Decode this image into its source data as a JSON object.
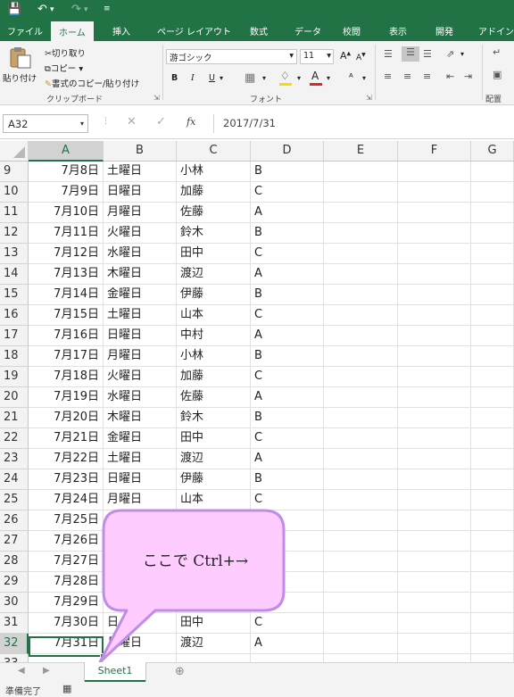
{
  "qat": {
    "save_icon": "save-icon",
    "undo_icon": "undo-icon",
    "redo_icon": "redo-icon",
    "customize_icon": "customize-qat-icon"
  },
  "tabs": [
    "ファイル",
    "ホーム",
    "挿入",
    "ページ レイアウト",
    "数式",
    "データ",
    "校閲",
    "表示",
    "開発",
    "アドイン"
  ],
  "active_tab": "ホーム",
  "ribbon": {
    "paste": "貼り付け",
    "cut": "切り取り",
    "copy": "コピー",
    "format_painter": "書式のコピー/貼り付け",
    "clipboard_group": "クリップボード",
    "font_name": "游ゴシック",
    "font_size": "11",
    "font_group": "フォント",
    "alignment_group": "配置",
    "bold": "B",
    "italic": "I",
    "underline": "U",
    "grow_font": "A",
    "shrink_font": "A",
    "font_color_letter": "A"
  },
  "formula_bar": {
    "name_box": "A32",
    "fx": "fx",
    "value": "2017/7/31"
  },
  "columns": [
    "A",
    "B",
    "C",
    "D",
    "E",
    "F",
    "G"
  ],
  "rows": [
    {
      "num": "9",
      "a": "7月8日",
      "b": "土曜日",
      "c": "小林",
      "d": "B"
    },
    {
      "num": "10",
      "a": "7月9日",
      "b": "日曜日",
      "c": "加藤",
      "d": "C"
    },
    {
      "num": "11",
      "a": "7月10日",
      "b": "月曜日",
      "c": "佐藤",
      "d": "A"
    },
    {
      "num": "12",
      "a": "7月11日",
      "b": "火曜日",
      "c": "鈴木",
      "d": "B"
    },
    {
      "num": "13",
      "a": "7月12日",
      "b": "水曜日",
      "c": "田中",
      "d": "C"
    },
    {
      "num": "14",
      "a": "7月13日",
      "b": "木曜日",
      "c": "渡辺",
      "d": "A"
    },
    {
      "num": "15",
      "a": "7月14日",
      "b": "金曜日",
      "c": "伊藤",
      "d": "B"
    },
    {
      "num": "16",
      "a": "7月15日",
      "b": "土曜日",
      "c": "山本",
      "d": "C"
    },
    {
      "num": "17",
      "a": "7月16日",
      "b": "日曜日",
      "c": "中村",
      "d": "A"
    },
    {
      "num": "18",
      "a": "7月17日",
      "b": "月曜日",
      "c": "小林",
      "d": "B"
    },
    {
      "num": "19",
      "a": "7月18日",
      "b": "火曜日",
      "c": "加藤",
      "d": "C"
    },
    {
      "num": "20",
      "a": "7月19日",
      "b": "水曜日",
      "c": "佐藤",
      "d": "A"
    },
    {
      "num": "21",
      "a": "7月20日",
      "b": "木曜日",
      "c": "鈴木",
      "d": "B"
    },
    {
      "num": "22",
      "a": "7月21日",
      "b": "金曜日",
      "c": "田中",
      "d": "C"
    },
    {
      "num": "23",
      "a": "7月22日",
      "b": "土曜日",
      "c": "渡辺",
      "d": "A"
    },
    {
      "num": "24",
      "a": "7月23日",
      "b": "日曜日",
      "c": "伊藤",
      "d": "B"
    },
    {
      "num": "25",
      "a": "7月24日",
      "b": "月曜日",
      "c": "山本",
      "d": "C"
    },
    {
      "num": "26",
      "a": "7月25日",
      "b": "",
      "c": "",
      "d": ""
    },
    {
      "num": "27",
      "a": "7月26日",
      "b": "",
      "c": "",
      "d": ""
    },
    {
      "num": "28",
      "a": "7月27日",
      "b": "",
      "c": "",
      "d": ""
    },
    {
      "num": "29",
      "a": "7月28日",
      "b": "",
      "c": "",
      "d": ""
    },
    {
      "num": "30",
      "a": "7月29日",
      "b": "",
      "c": "",
      "d": ""
    },
    {
      "num": "31",
      "a": "7月30日",
      "b": "日",
      "c": "田中",
      "d": "C"
    },
    {
      "num": "32",
      "a": "7月31日",
      "b": "月曜日",
      "c": "渡辺",
      "d": "A"
    },
    {
      "num": "33",
      "a": "",
      "b": "",
      "c": "",
      "d": ""
    }
  ],
  "selected_cell": "A32",
  "callout": {
    "text": "ここで Ctrl+→",
    "fill": "#ffccff",
    "stroke": "#bf8ce6"
  },
  "sheet_tab": "Sheet1",
  "status": "準備完了",
  "colors": {
    "excel_green": "#217346",
    "ribbon_bg": "#f3f3f3",
    "font_color_bar": "#e0261f",
    "highlight_bar": "#ffd700"
  }
}
